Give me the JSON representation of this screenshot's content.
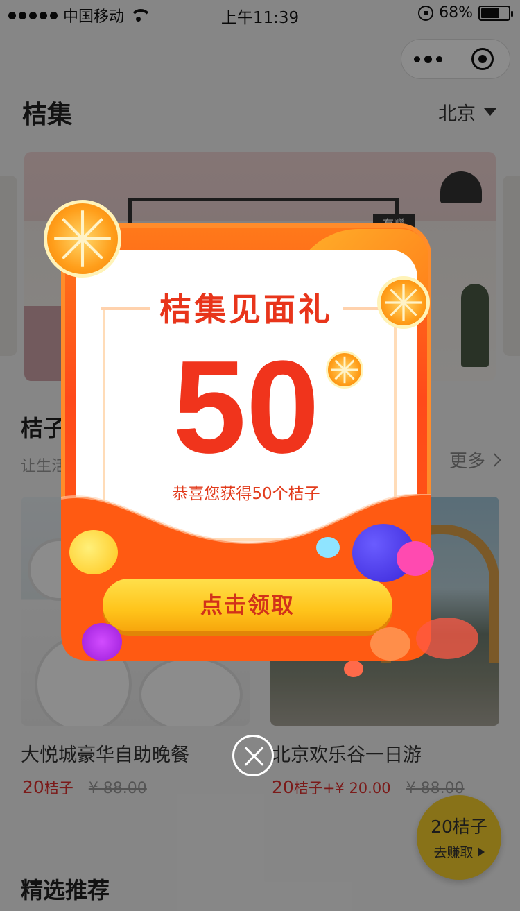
{
  "status_bar": {
    "carrier": "中国移动",
    "time": "上午11:39",
    "battery": "68%",
    "battery_level": 0.68
  },
  "header": {
    "title": "桔集",
    "city": "北京"
  },
  "banner": {
    "tag": "有赠"
  },
  "section_oranges": {
    "title": "桔子",
    "subtitle": "让生活",
    "more": "更多"
  },
  "products": [
    {
      "name": "大悦城豪华自助晚餐",
      "price_num": "20",
      "price_unit": "桔子",
      "price_extra": "",
      "original": "¥ 88.00"
    },
    {
      "name": "北京欢乐谷一日游",
      "price_num": "20",
      "price_unit": "桔子",
      "price_extra": "+¥ 20.00",
      "original": "¥ 88.00"
    }
  ],
  "float_button": {
    "count": "20桔子",
    "label": "去赚取"
  },
  "section_recommend": {
    "title": "精选推荐"
  },
  "popup": {
    "title": "桔集见面礼",
    "amount": "50",
    "description": "恭喜您获得50个桔子",
    "button": "点击领取"
  }
}
